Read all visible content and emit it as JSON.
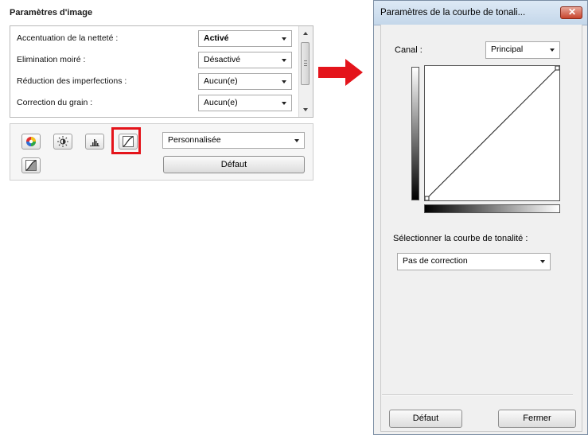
{
  "left_panel": {
    "title": "Paramètres d'image",
    "rows": [
      {
        "label": "Accentuation de la netteté :",
        "value": "Activé"
      },
      {
        "label": "Elimination moiré :",
        "value": "Désactivé"
      },
      {
        "label": "Réduction des imperfections :",
        "value": "Aucun(e)"
      },
      {
        "label": "Correction du grain :",
        "value": "Aucun(e)"
      }
    ],
    "tools": {
      "icons": [
        "color-wheel-icon",
        "brightness-icon",
        "histogram-icon",
        "tone-curve-icon",
        "final-review-icon"
      ],
      "preset_value": "Personnalisée",
      "default_label": "Défaut"
    }
  },
  "dialog": {
    "title": "Paramètres de la courbe de tonali...",
    "close_label": "✕",
    "channel_label": "Canal :",
    "channel_value": "Principal",
    "curve_select_label": "Sélectionner la courbe de tonalité :",
    "curve_select_value": "Pas de correction",
    "default_label": "Défaut",
    "close_button_label": "Fermer"
  },
  "colors": {
    "highlight": "#e4141b",
    "arrow": "#e4141b",
    "titlebar": "#c4d7ea"
  }
}
